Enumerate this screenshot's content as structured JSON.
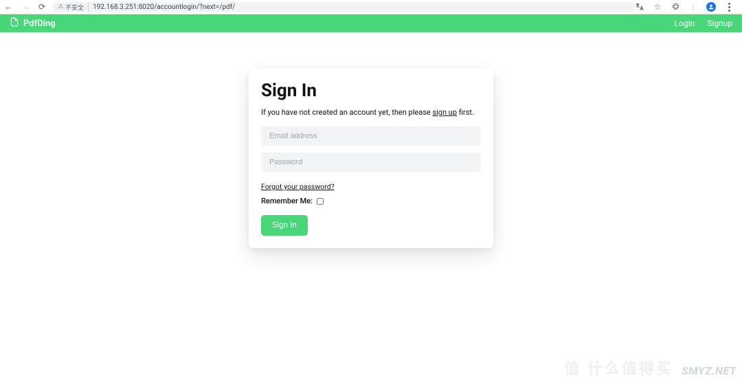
{
  "browser": {
    "insecure_label": "不安全",
    "url": "192.168.3.251:8020/accountlogin/?next=/pdf/"
  },
  "header": {
    "brand": "PdfDing",
    "login": "Login",
    "signup": "Signup"
  },
  "signin": {
    "title": "Sign In",
    "subtext_prefix": "If you have not created an account yet, then please ",
    "signup_link": "sign up",
    "subtext_suffix": " first.",
    "email_placeholder": "Email address",
    "password_placeholder": "Password",
    "forgot": "Forgot your password?",
    "remember_label": "Remember Me:",
    "button": "Sign In"
  },
  "watermark": {
    "right": "SMYZ.NET",
    "center": "值 什么值得买"
  }
}
